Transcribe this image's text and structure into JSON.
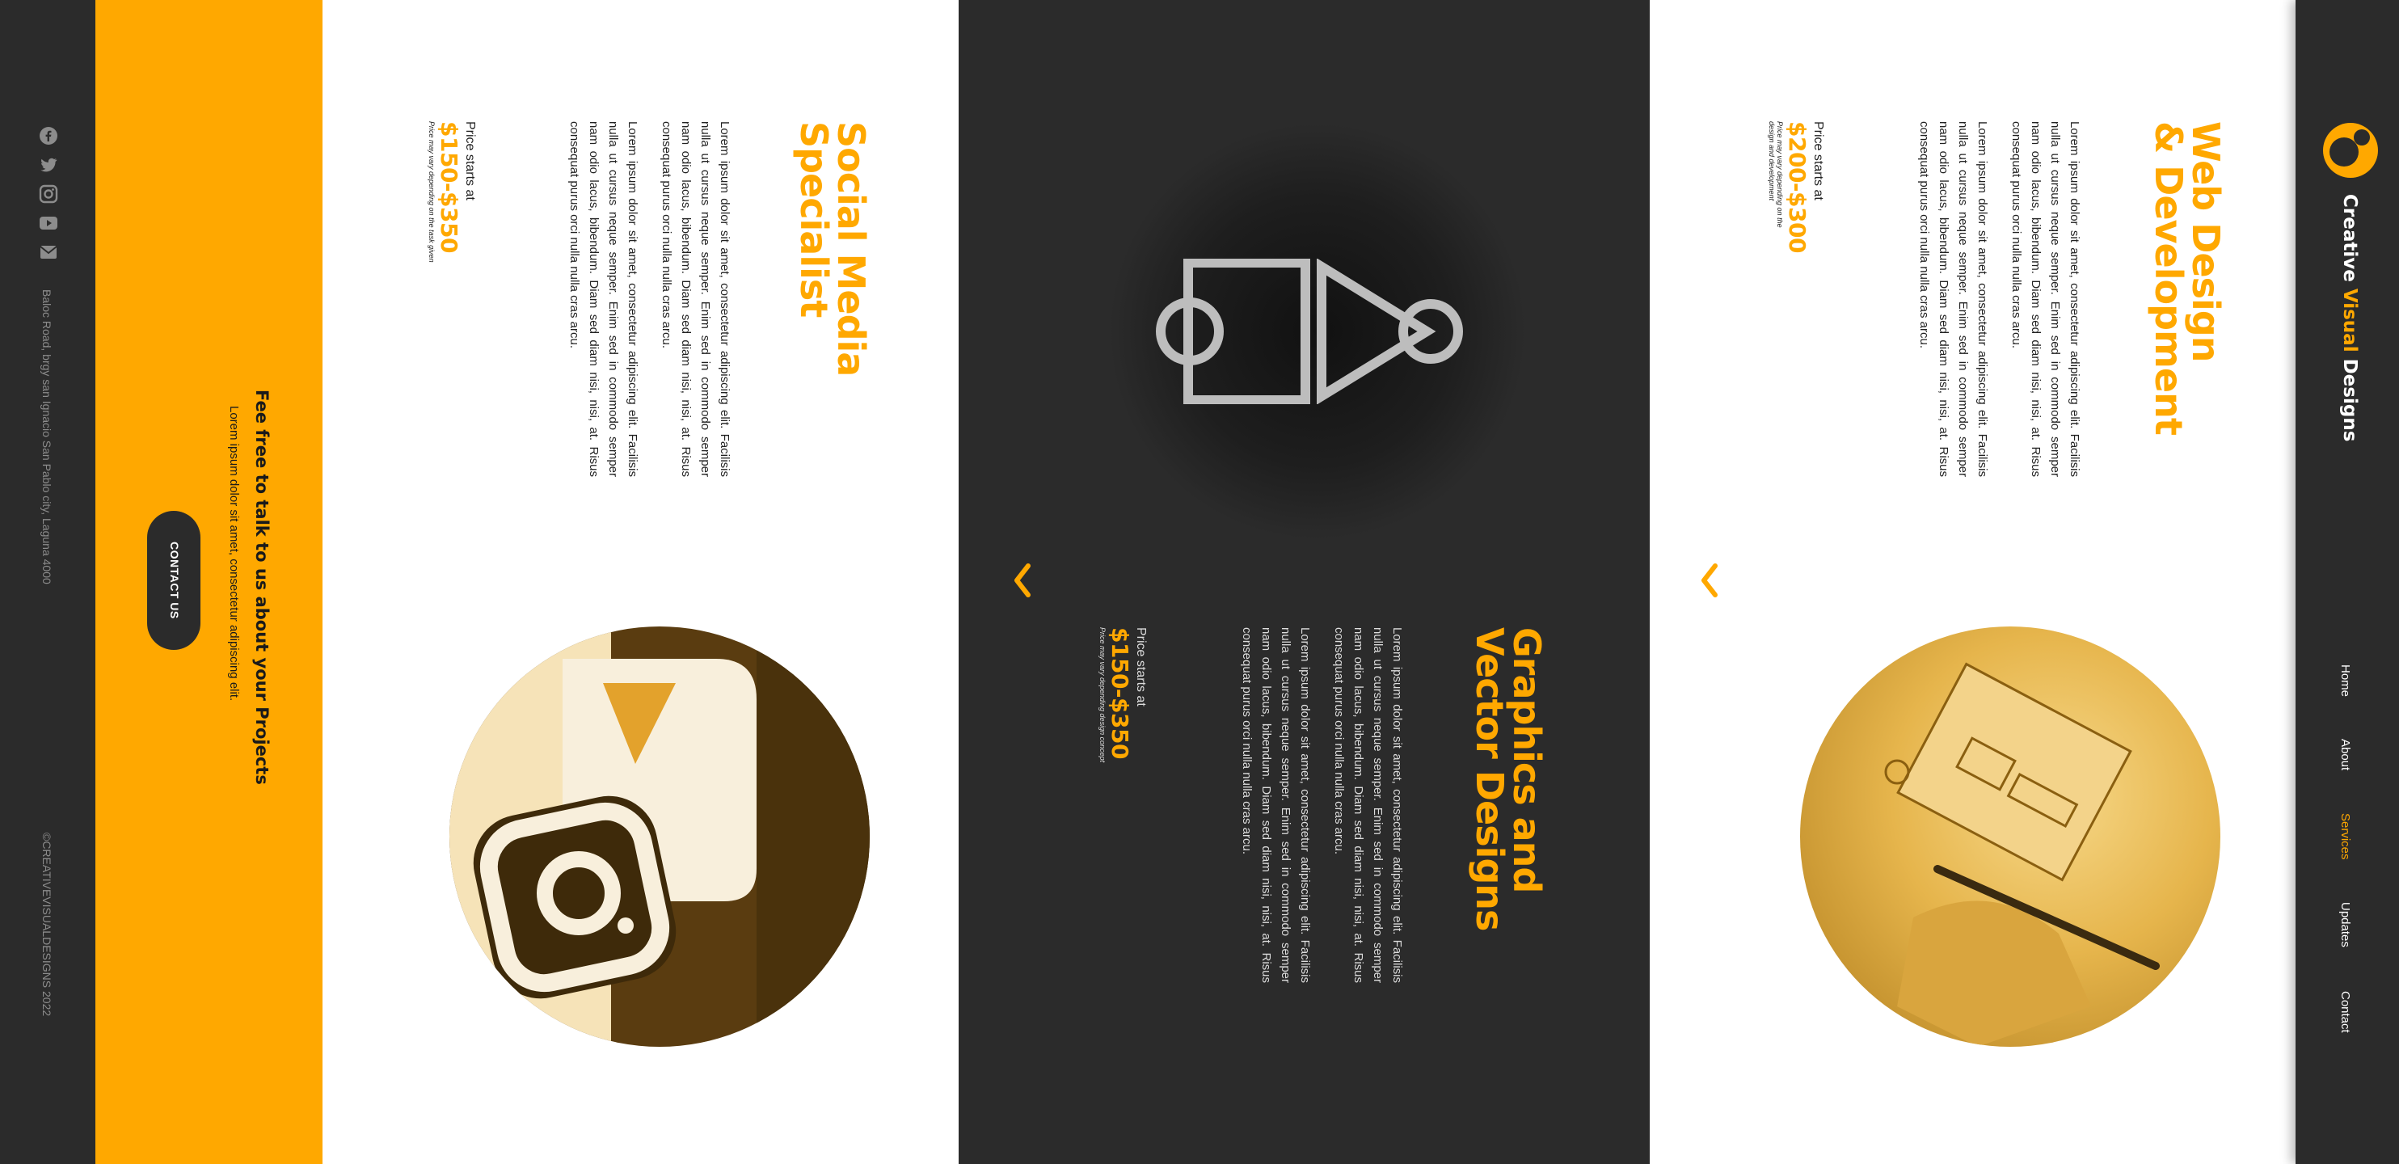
{
  "brand": {
    "name_part1": "Creative ",
    "name_part2": "Visual",
    "name_part3": " Designs"
  },
  "nav": {
    "items": [
      {
        "label": "Home"
      },
      {
        "label": "About"
      },
      {
        "label": "Services"
      },
      {
        "label": "Updates"
      },
      {
        "label": "Contact"
      }
    ],
    "active": "Services"
  },
  "services": {
    "web": {
      "title_line1": "Web Design",
      "title_line2": "& Development",
      "para1": "Lorem ipsum dolor sit amet, consectetur adipiscing elit. Facilisis nulla ut cursus neque semper. Enim sed in commodo semper nam odio lacus, bibendum. Diam sed diam nisi, nisi, at. Risus consequat purus orci nulla nulla cras arcu.",
      "para2": "Lorem ipsum dolor sit amet, consectetur adipiscing elit. Facilisis nulla ut cursus neque semper. Enim sed in commodo semper nam odio lacus, bibendum. Diam sed diam nisi, nisi, at. Risus consequat purus orci nulla nulla cras arcu.",
      "price_label": "Price starts at",
      "price": "$200-$300",
      "note": "Price may vary depending on the design and development"
    },
    "graphics": {
      "title_line1": "Graphics and",
      "title_line2": "Vector Designs",
      "para1": "Lorem ipsum dolor sit amet, consectetur adipiscing elit. Facilisis nulla ut cursus neque semper. Enim sed in commodo semper nam odio lacus, bibendum. Diam sed diam nisi, nisi, at. Risus consequat purus orci nulla nulla cras arcu.",
      "para2": "Lorem ipsum dolor sit amet, consectetur adipiscing elit. Facilisis nulla ut cursus neque semper. Enim sed in commodo semper nam odio lacus, bibendum. Diam sed diam nisi, nisi, at. Risus consequat purus orci nulla nulla cras arcu.",
      "price_label": "Price starts at",
      "price": "$150-$350",
      "note": "Price may vary depending design concept"
    },
    "social": {
      "title_line1": "Social Media",
      "title_line2": "Specialist",
      "para1": "Lorem ipsum dolor sit amet, consectetur adipiscing elit. Facilisis nulla ut cursus neque semper. Enim sed in commodo semper nam odio lacus, bibendum. Diam sed diam nisi, nisi, at. Risus consequat purus orci nulla nulla cras arcu.",
      "para2": "Lorem ipsum dolor sit amet, consectetur adipiscing elit. Facilisis nulla ut cursus neque semper. Enim sed in commodo semper nam odio lacus, bibendum. Diam sed diam nisi, nisi, at. Risus consequat purus orci nulla nulla cras arcu.",
      "price_label": "Price starts at",
      "price": "$150-$350",
      "note": "Price may vary depending on the task given"
    }
  },
  "cta": {
    "heading": "Fee free to talk to us about your Projects",
    "sub": "Lorem ipsum dolor sit amet, consectetur adipiscing elit.",
    "button": "CONTACT US"
  },
  "footer": {
    "address": "Baloc Road, brgy san Ignacio San Pablo city, Laguna 4000",
    "copyright": "©CREATIVEVISUALDESIGNS 2022"
  },
  "social_icons": [
    "facebook-icon",
    "twitter-icon",
    "instagram-icon",
    "youtube-icon",
    "email-icon"
  ],
  "colors": {
    "accent": "#ffa800",
    "dark": "#2b2b2b",
    "light": "#ffffff"
  }
}
